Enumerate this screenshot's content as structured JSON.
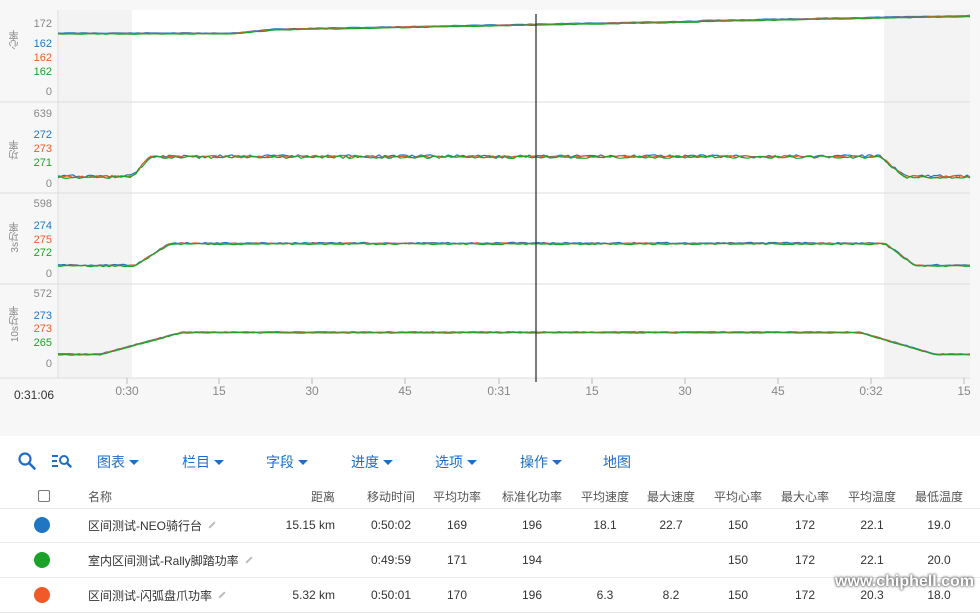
{
  "panels": [
    {
      "label": "心率",
      "max": "172",
      "min": "0",
      "values": [
        "162",
        "162",
        "162"
      ]
    },
    {
      "label": "功率",
      "max": "639",
      "min": "0",
      "values": [
        "272",
        "273",
        "271"
      ]
    },
    {
      "label": "3s功率",
      "max": "598",
      "min": "0",
      "values": [
        "274",
        "275",
        "272"
      ]
    },
    {
      "label": "10s功率",
      "max": "572",
      "min": "0",
      "values": [
        "273",
        "273",
        "265"
      ]
    }
  ],
  "series_colors": [
    "#1f77c4",
    "#f05a28",
    "#1aa328"
  ],
  "x_ticks": [
    "0:30",
    "15",
    "30",
    "45",
    "0:31",
    "15",
    "30",
    "45",
    "0:32",
    "15"
  ],
  "cursor_time": "0:31:06",
  "toolbar": {
    "icons": [
      "search-icon",
      "zoom-list-icon"
    ],
    "menus": [
      "图表",
      "栏目",
      "字段",
      "进度",
      "选项",
      "操作"
    ],
    "map_label": "地图"
  },
  "table": {
    "headers": [
      "名称",
      "距离",
      "移动时间",
      "平均功率",
      "标准化功率",
      "平均速度",
      "最大速度",
      "平均心率",
      "最大心率",
      "平均温度",
      "最低温度"
    ],
    "rows": [
      {
        "color": "#1f77c4",
        "name": "区间测试-NEO骑行台",
        "distance": "15.15 km",
        "moving": "0:50:02",
        "avg_power": "169",
        "np": "196",
        "avg_speed": "18.1",
        "max_speed": "22.7",
        "avg_hr": "150",
        "max_hr": "172",
        "avg_temp": "22.1",
        "min_temp": "19.0"
      },
      {
        "color": "#1aa328",
        "name": "室内区间测试-Rally脚踏功率",
        "distance": "",
        "moving": "0:49:59",
        "avg_power": "171",
        "np": "194",
        "avg_speed": "",
        "max_speed": "",
        "avg_hr": "150",
        "max_hr": "172",
        "avg_temp": "22.1",
        "min_temp": "20.0"
      },
      {
        "color": "#f05a28",
        "name": "区间测试-闪弧盘爪功率",
        "distance": "5.32 km",
        "moving": "0:50:01",
        "avg_power": "170",
        "np": "196",
        "avg_speed": "6.3",
        "max_speed": "8.2",
        "avg_hr": "150",
        "max_hr": "172",
        "avg_temp": "20.3",
        "min_temp": "18.0"
      }
    ]
  },
  "watermark": "www.chiphell.com"
}
